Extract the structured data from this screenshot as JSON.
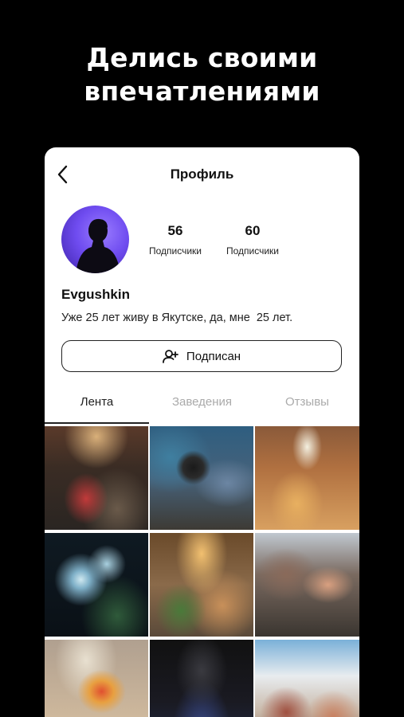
{
  "promo": {
    "line1": "Делись своими",
    "line2": "впечатлениями"
  },
  "header": {
    "title": "Профиль",
    "back_icon": "chevron-left-icon"
  },
  "profile": {
    "username": "Evgushkin",
    "bio": "Уже 25 лет живу в Якутске, да, мне  25 лет.",
    "stats": [
      {
        "value": "56",
        "label": "Подписчики"
      },
      {
        "value": "60",
        "label": "Подписчики"
      }
    ],
    "follow_button": {
      "label": "Подписан",
      "icon": "user-plus-icon"
    }
  },
  "tabs": [
    {
      "label": "Лента",
      "active": true
    },
    {
      "label": "Заведения",
      "active": false
    },
    {
      "label": "Отзывы",
      "active": false
    }
  ],
  "colors": {
    "background": "#000000",
    "card": "#ffffff",
    "text": "#111111",
    "inactive_tab": "#aaaaaa",
    "avatar_accent": "#6f4cf0"
  }
}
